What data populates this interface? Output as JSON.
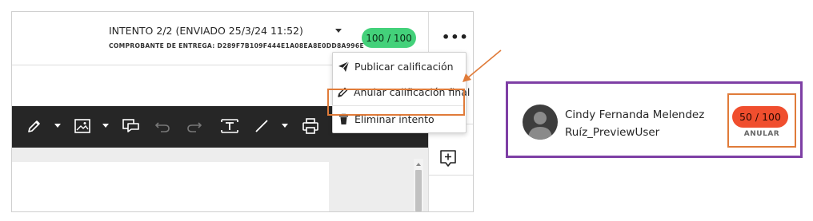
{
  "header": {
    "attempt_title": "INTENTO 2/2 (ENVIADO 25/3/24 11:52)",
    "receipt": "COMPROBANTE DE ENTREGA: D289F7B109F444E1A08EA8E0DD8A996E",
    "grade": "100 / 100",
    "more_icon": "•••"
  },
  "menu": {
    "items": [
      {
        "label": "Publicar calificación",
        "icon": "paper-plane-icon"
      },
      {
        "label": "Anular calificación final",
        "icon": "pencil-icon"
      },
      {
        "label": "Eliminar intento",
        "icon": "trash-icon"
      }
    ]
  },
  "toolbar": {
    "icons": [
      "pencil-icon",
      "image-icon",
      "comment-icon",
      "undo-icon",
      "redo-icon",
      "text-box-icon",
      "line-icon",
      "print-icon"
    ]
  },
  "student_card": {
    "name": "Cindy Fernanda Melendez Ruíz_PreviewUser",
    "grade": "50 / 100",
    "override_label": "ANULAR"
  },
  "colors": {
    "green_grade": "#43d17a",
    "red_grade": "#f04e2e",
    "highlight_orange": "#e07b39",
    "card_border_purple": "#7e3fa5",
    "toolbar_dark": "#262626"
  }
}
